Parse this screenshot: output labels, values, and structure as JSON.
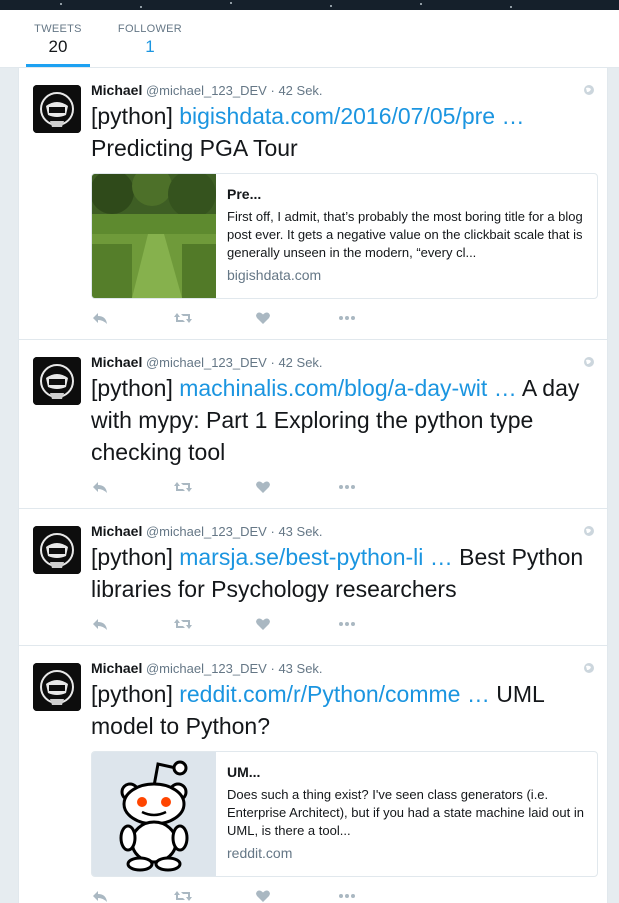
{
  "stats": [
    {
      "label": "TWEETS",
      "value": "20"
    },
    {
      "label": "FOLLOWER",
      "value": "1"
    }
  ],
  "tweets": [
    {
      "name": "Michael",
      "handle": "@michael_123_DEV",
      "separator": "·",
      "time": "42 Sek.",
      "tag": "[python]",
      "link": "bigishdata.com/2016/07/05/pre …",
      "text": "Predicting PGA Tour",
      "card": {
        "title": "Pre...",
        "desc": "First off, I admit, that’s probably the most boring title for a blog post ever. It gets a negative value on the clickbait scale that is generally unseen in the modern, “every cl...",
        "domain": "bigishdata.com",
        "image": "golf-course-photo"
      }
    },
    {
      "name": "Michael",
      "handle": "@michael_123_DEV",
      "separator": "·",
      "time": "42 Sek.",
      "tag": "[python]",
      "link": "machinalis.com/blog/a-day-wit …",
      "text": "A day with mypy: Part 1 Exploring the python type checking tool"
    },
    {
      "name": "Michael",
      "handle": "@michael_123_DEV",
      "separator": "·",
      "time": "43 Sek.",
      "tag": "[python]",
      "link": "marsja.se/best-python-li …",
      "text": "Best Python libraries for Psychology researchers"
    },
    {
      "name": "Michael",
      "handle": "@michael_123_DEV",
      "separator": "·",
      "time": "43 Sek.",
      "tag": "[python]",
      "link": "reddit.com/r/Python/comme …",
      "text": "UML model to Python?",
      "card": {
        "title": "UM...",
        "desc": "Does such a thing exist? I've seen class generators (i.e. Enterprise Architect), but if you had a state machine laid out in UML, is there a tool...",
        "domain": "reddit.com",
        "image": "reddit-alien-logo"
      }
    }
  ],
  "colors": {
    "link": "#1b95e0",
    "muted": "#657786",
    "accent": "#1da1f2"
  },
  "icons": [
    "reply-icon",
    "retweet-icon",
    "like-icon",
    "more-icon",
    "globe-icon"
  ]
}
